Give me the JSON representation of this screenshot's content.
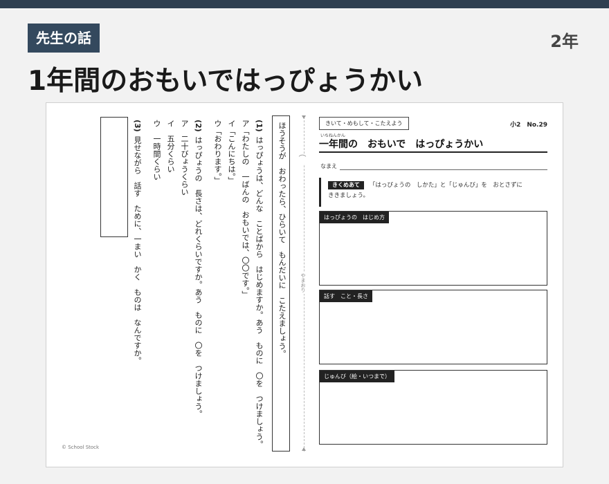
{
  "header": {
    "badge": "先生の話",
    "grade": "2年",
    "title": "1年間のおもいではっぴょうかい"
  },
  "left": {
    "instruction": "ほうそうが　おわったら、ひらいて　もんだいに　こたえましょう。",
    "q1": {
      "number": "(1)",
      "text": "はっぴょうは、どんな　ことばから　はじめますか。あう　ものに　〇を　つけましょう。",
      "options": [
        "ア「わたしの　一ばんの　おもいでは、〇〇です。」",
        "イ「こんにちは。」",
        "ウ「おわります。」"
      ]
    },
    "q2": {
      "number": "(2)",
      "text": "はっぴょうの　長さは、どれくらいですか。あう　ものに　〇を　つけましょう。",
      "options": [
        "ア　二十びょうくらい",
        "イ　五分くらい",
        "ウ　一時間くらい"
      ]
    },
    "q3": {
      "number": "(3)",
      "text": "見せながら　話す　ために、一まい　かく　ものは　なんですか。"
    },
    "copyright": "© School Stock"
  },
  "fold": {
    "icon": "⌒",
    "label": "やまおり"
  },
  "right": {
    "head_box": "きいて・めもして・こたえよう",
    "number": "小2　No.29",
    "ruby": "いちねんかん",
    "title": "一年間の　おもいで　はっぴょうかい",
    "name_label": "なまえ",
    "listen_tag": "きくめあて",
    "listen_text_1": "「はっぴょうの　しかた」と「じゅんび」を　おとさずに",
    "listen_text_2": "ききましょう。",
    "panels": [
      "はっぴょうの　はじめ方",
      "話す　こと・長さ",
      "じゅんび（絵・いつまで）"
    ]
  }
}
